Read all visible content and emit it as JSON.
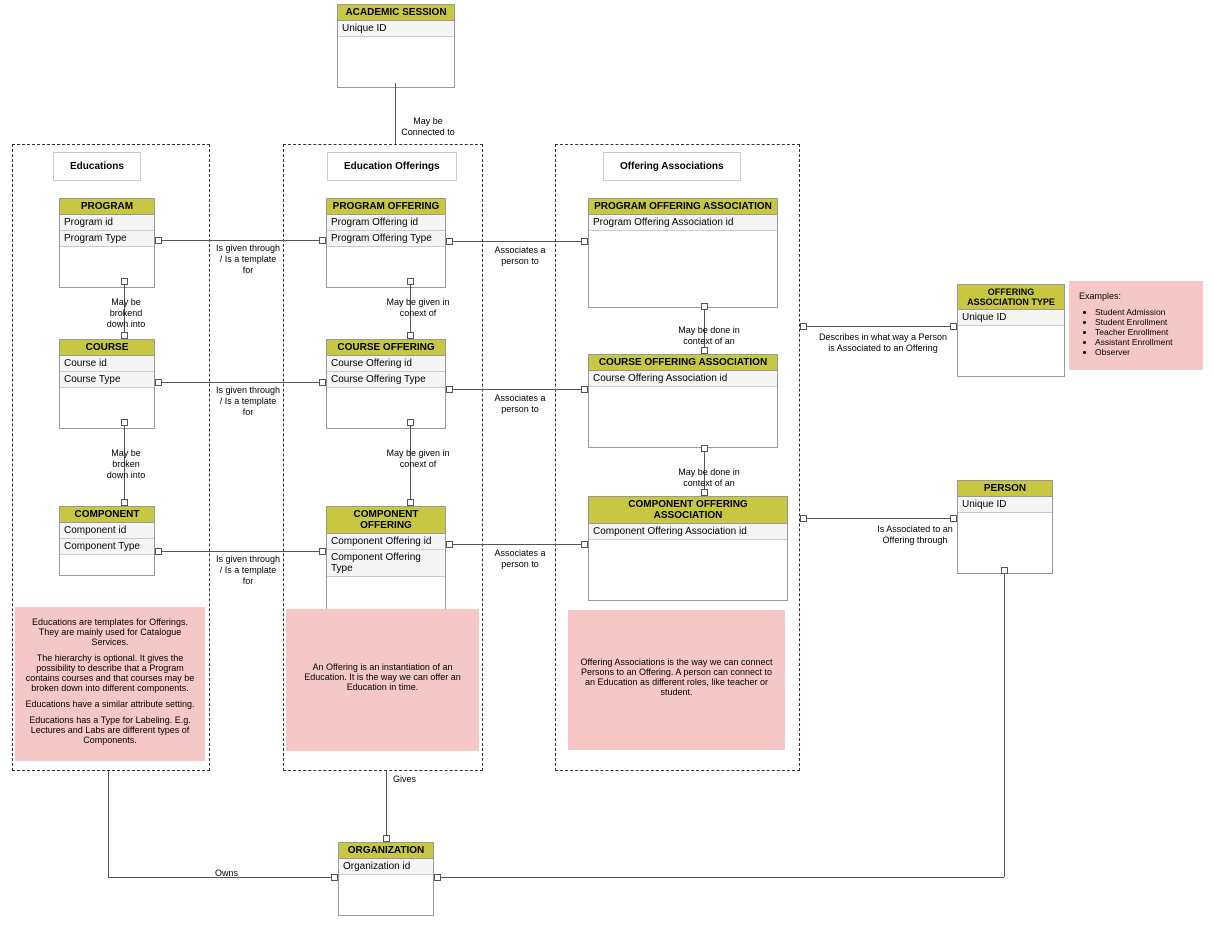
{
  "entities": {
    "academicSession": {
      "title": "ACADEMIC SESSION",
      "attrs": [
        "Unique ID"
      ]
    },
    "program": {
      "title": "PROGRAM",
      "attrs": [
        "Program id",
        "Program Type"
      ]
    },
    "course": {
      "title": "COURSE",
      "attrs": [
        "Course id",
        "Course Type"
      ]
    },
    "component": {
      "title": "COMPONENT",
      "attrs": [
        "Component id",
        "Component Type"
      ]
    },
    "programOffering": {
      "title": "PROGRAM OFFERING",
      "attrs": [
        "Program Offering id",
        "Program Offering Type"
      ]
    },
    "courseOffering": {
      "title": "COURSE OFFERING",
      "attrs": [
        "Course Offering id",
        "Course Offering Type"
      ]
    },
    "componentOffering": {
      "title": "COMPONENT OFFERING",
      "attrs": [
        "Component Offering id",
        "Component Offering Type"
      ]
    },
    "programOfferingAssoc": {
      "title": "PROGRAM OFFERING ASSOCIATION",
      "attrs": [
        "Program Offering Association id"
      ]
    },
    "courseOfferingAssoc": {
      "title": "COURSE OFFERING ASSOCIATION",
      "attrs": [
        "Course Offering Association id"
      ]
    },
    "componentOfferingAssoc": {
      "title": "COMPONENT OFFERING ASSOCIATION",
      "attrs": [
        "Component Offering Association id"
      ]
    },
    "offeringAssocType": {
      "title": "OFFERING ASSOCIATION TYPE",
      "attrs": [
        "Unique ID"
      ]
    },
    "person": {
      "title": "PERSON",
      "attrs": [
        "Unique ID"
      ]
    },
    "organization": {
      "title": "ORGANIZATION",
      "attrs": [
        "Organization id"
      ]
    }
  },
  "groups": {
    "educations": "Educations",
    "educationOfferings": "Education Offerings",
    "offeringAssociations": "Offering Associations"
  },
  "labels": {
    "mayBeConnectedTo": "May be\nConnected to",
    "mayBeBrokenDownInto": "May be\nbrokend\ndown into",
    "mayBeBrokenDownInto2": "May be\nbroken\ndown into",
    "isGivenThroughTemplate": "Is given through\n/ Is a template\nfor",
    "mayBeGivenInContext": "May be given in\nconext of",
    "associatesPersonTo": "Associates a\nperson to",
    "mayBeDoneInContextOfAn": "May be done in\ncontext of an",
    "describesInWay": "Describes in what way a Person\nis Associated to an Offering",
    "isAssociatedToOfferingThrough": "Is Associated to an\nOffering through",
    "gives": "Gives",
    "owns": "Owns"
  },
  "notes": {
    "educations": [
      "Educations are templates for Offerings. They are mainly used for Catalogue Services.",
      "The hierarchy is optional. It gives the possibility to describe that a Program contains courses and that courses may be broken down into different components.",
      "Educations have a similar attribute setting.",
      "Educations has a Type for Labeling. E.g. Lectures and Labs are different types of Components."
    ],
    "offerings": [
      "An Offering is an instantiation of an Education. It is the way we can offer an Education in time."
    ],
    "associations": [
      "Offering Associations is the way we can connect Persons to an Offering. A person can connect to an Education as different roles, like teacher or student."
    ],
    "examplesTitle": "Examples:",
    "examples": [
      "Student Admission",
      "Student Enrollment",
      "Teacher Enrollment",
      "Assistant Enrollment",
      "Observer"
    ]
  }
}
